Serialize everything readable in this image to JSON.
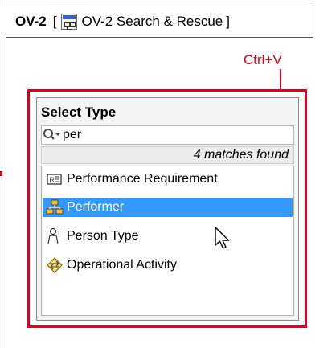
{
  "tab": {
    "id": "OV-2",
    "open_bracket": "[",
    "name": "OV-2 Search & Rescue",
    "close_bracket": "]"
  },
  "annotation": {
    "shortcut": "Ctrl+V",
    "color": "#e2001a"
  },
  "popup": {
    "title": "Select Type",
    "search": {
      "value": "per",
      "icon": "search-icon"
    },
    "matches_text": "4 matches found",
    "results": [
      {
        "label": "Performance Requirement",
        "icon": "requirement-icon",
        "selected": false
      },
      {
        "label": "Performer",
        "icon": "performer-icon",
        "selected": true
      },
      {
        "label": "Person Type",
        "icon": "person-type-icon",
        "selected": false
      },
      {
        "label": "Operational Activity",
        "icon": "operational-activity-icon",
        "selected": false
      }
    ],
    "selection_color": "#3399ff"
  }
}
